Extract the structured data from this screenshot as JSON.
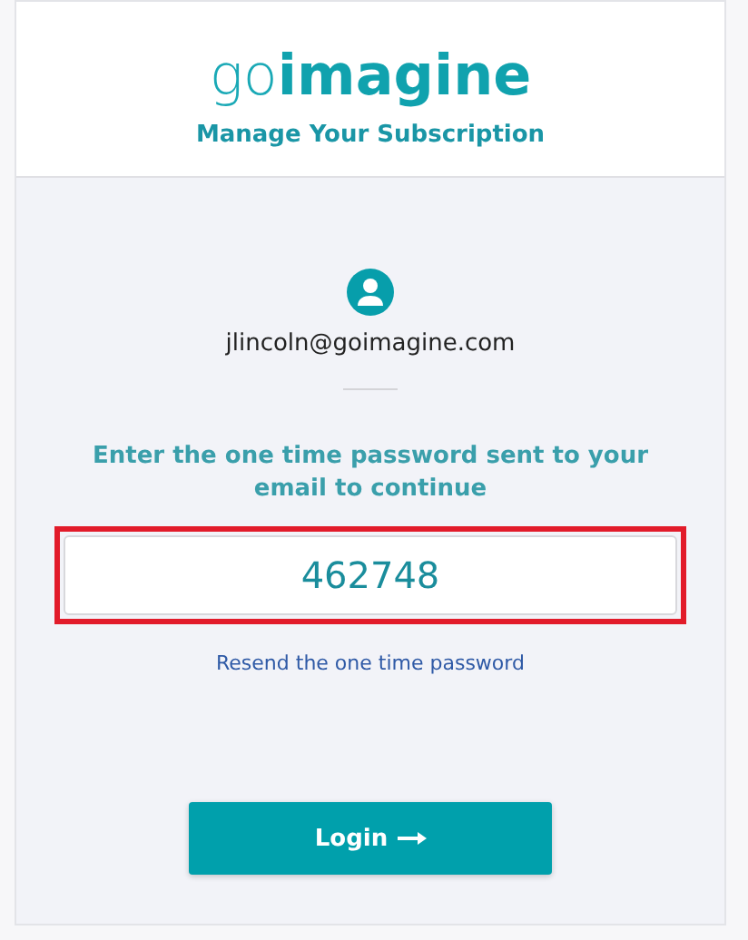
{
  "header": {
    "logo": "go**imagine**",
    "title": "Manage Your Subscription"
  },
  "account": {
    "email": "jlincoln@goimagine.com"
  },
  "prompt": "Enter the one time password sent to your email to continue",
  "otp_field": {
    "value": "462748",
    "highlighted": true
  },
  "resend_link": "Resend the one time password",
  "login_button": {
    "label": "Login"
  }
}
